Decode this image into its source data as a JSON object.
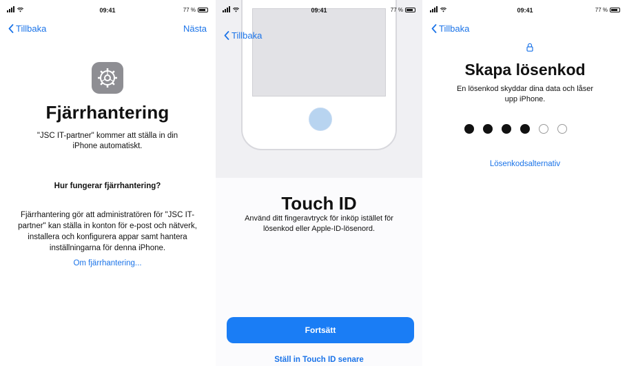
{
  "status_bar": {
    "time": "09:41",
    "battery": "77 %"
  },
  "nav": {
    "back_label": "Tillbaka",
    "next_label": "Nästa"
  },
  "screen1": {
    "icon": "gear-icon",
    "title": "Fjärrhantering",
    "subtitle": "\"JSC IT-partner\" kommer att ställa in din iPhone automatiskt.",
    "question": "Hur fungerar fjärrhantering?",
    "body": "Fjärrhantering gör att administratören för \"JSC IT-partner\" kan ställa in konton för e-post och nätverk, installera och konfigurera appar samt hantera inställningarna för denna iPhone.",
    "more_link": "Om fjärrhantering..."
  },
  "screen2": {
    "title": "Touch ID",
    "subtitle": "Använd ditt fingeravtryck för inköp istället för lösenkod eller Apple-ID-lösenord.",
    "primary_button": "Fortsätt",
    "secondary_link": "Ställ in Touch ID senare"
  },
  "screen3": {
    "icon": "lock-icon",
    "title": "Skapa lösenkod",
    "subtitle": "En lösenkod skyddar dina data och låser upp iPhone.",
    "passcode": {
      "length": 6,
      "entered": 4
    },
    "options_link": "Lösenkodsalternativ"
  },
  "colors": {
    "accent": "#1a73e8",
    "button": "#1a7df5",
    "icon_gray": "#8e8e93"
  }
}
